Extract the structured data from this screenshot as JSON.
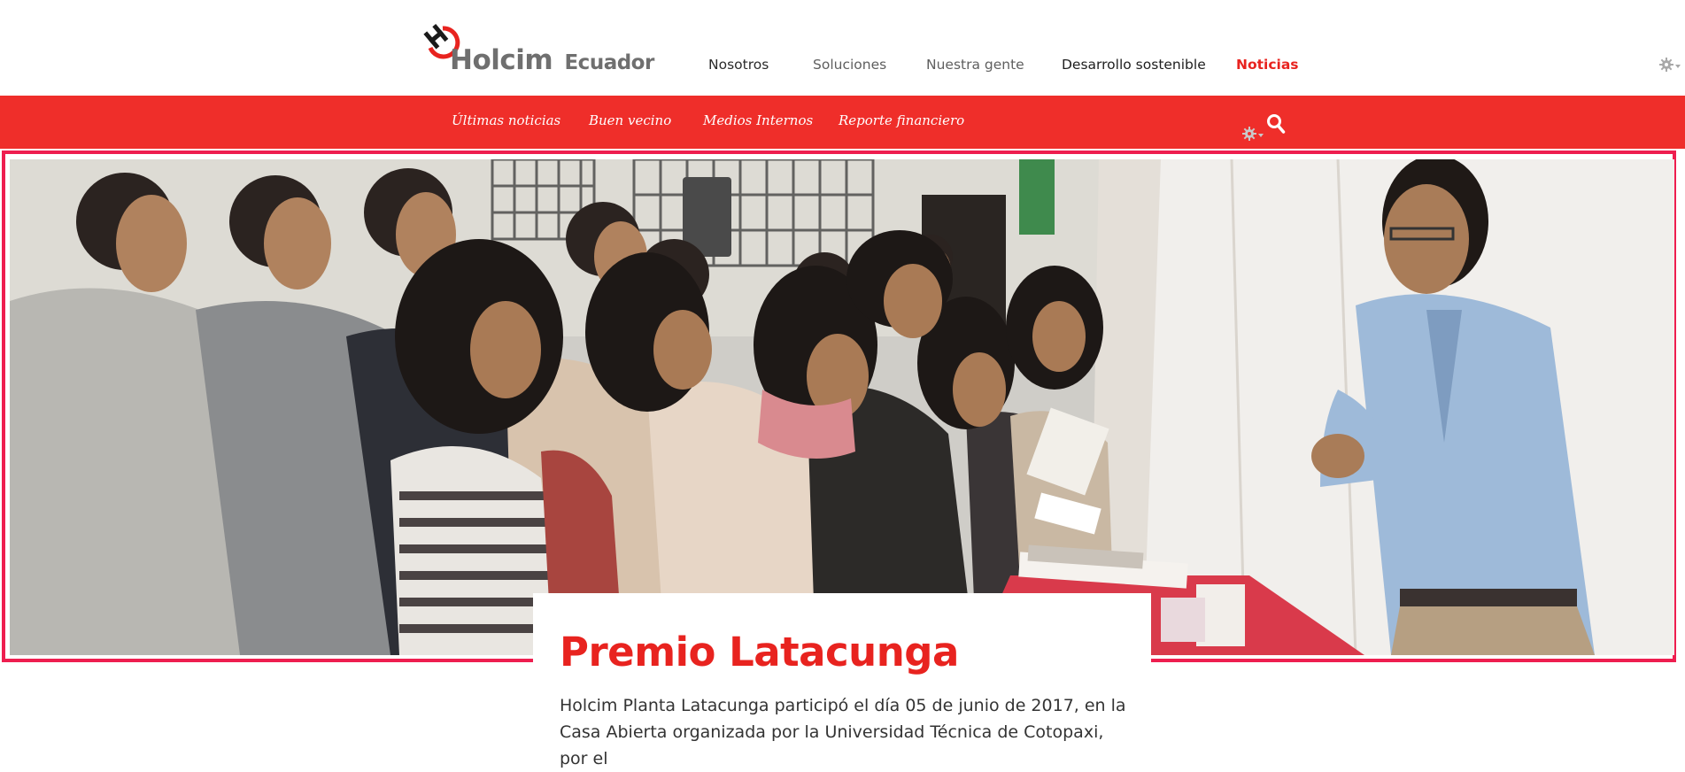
{
  "brand": {
    "name": "Holcim",
    "country": "Ecuador",
    "accent_color": "#e8231f",
    "bar_color": "#ef2e2a"
  },
  "main_nav": {
    "items": [
      {
        "label": "Nosotros"
      },
      {
        "label": "Soluciones"
      },
      {
        "label": "Nuestra gente"
      },
      {
        "label": "Desarrollo sostenible"
      },
      {
        "label": "Noticias",
        "active": true
      }
    ]
  },
  "sub_nav": {
    "items": [
      {
        "label": "Últimas noticias"
      },
      {
        "label": "Buen vecino"
      },
      {
        "label": "Medios Internos"
      },
      {
        "label": "Reporte financiero"
      }
    ]
  },
  "icons": {
    "gear_top": "gear-dropdown-icon",
    "gear_sub": "gear-dropdown-icon",
    "search": "search-icon"
  },
  "hero": {
    "image_semantic": "students-at-open-house-photo"
  },
  "article": {
    "title": "Premio Latacunga",
    "body_lines": [
      "Holcim Planta Latacunga participó el día 05 de junio de 2017, en la",
      "Casa Abierta organizada por la Universidad Técnica de Cotopaxi, por el"
    ]
  }
}
